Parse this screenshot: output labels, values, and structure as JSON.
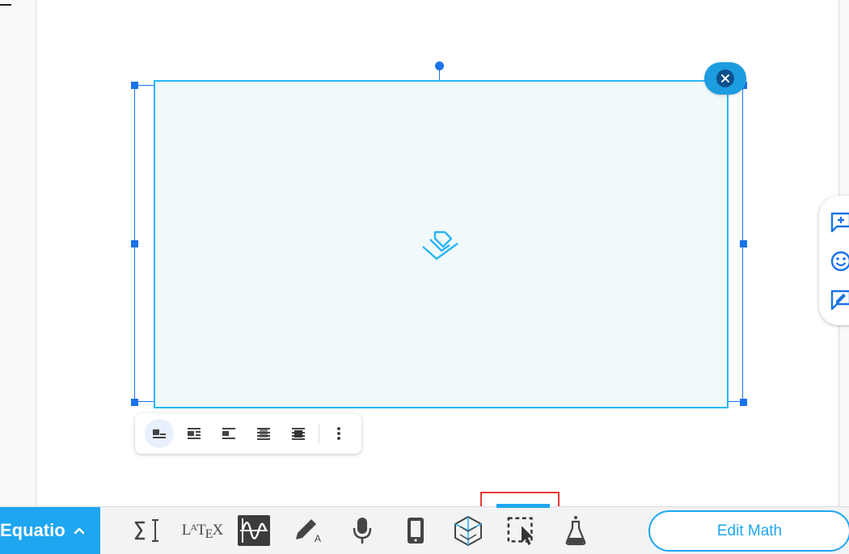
{
  "equatio_bar": {
    "brand_label": "Equatio",
    "edit_math_label": "Edit Math",
    "tools": [
      {
        "name": "Equation editor",
        "icon": "sigma-cursor-icon"
      },
      {
        "name": "LaTeX editor",
        "icon": "latex-icon",
        "label": "LATEX"
      },
      {
        "name": "Graph editor",
        "icon": "graph-wave-icon"
      },
      {
        "name": "Handwriting recognition",
        "icon": "pen-handwriting-icon"
      },
      {
        "name": "Speech input",
        "icon": "microphone-icon"
      },
      {
        "name": "Equatio mobile",
        "icon": "mobile-phone-icon"
      },
      {
        "name": "Geogebra",
        "icon": "cube-icon"
      },
      {
        "name": "Screenshot reader",
        "icon": "selection-cursor-icon",
        "active": true
      },
      {
        "name": "Chemistry",
        "icon": "flask-icon"
      }
    ]
  },
  "wrap_toolbar": {
    "options": [
      {
        "name": "In line",
        "icon": "wrap-inline-icon",
        "active": true
      },
      {
        "name": "Wrap text",
        "icon": "wrap-text-icon"
      },
      {
        "name": "Break text",
        "icon": "break-text-icon"
      },
      {
        "name": "Behind text",
        "icon": "behind-text-icon"
      },
      {
        "name": "In front of text",
        "icon": "in-front-text-icon"
      }
    ],
    "more_icon": "more-vert-icon"
  },
  "side_panel": {
    "buttons": [
      {
        "name": "Add comment",
        "icon": "add-comment-icon"
      },
      {
        "name": "Add emoji reaction",
        "icon": "emoji-icon"
      },
      {
        "name": "Suggest edits",
        "icon": "suggest-edit-icon"
      }
    ]
  },
  "colors": {
    "accent": "#1ea6f0",
    "selection": "#1a73e8",
    "highlight": "#e53935",
    "placeholder_bg": "#f1f9fd"
  }
}
